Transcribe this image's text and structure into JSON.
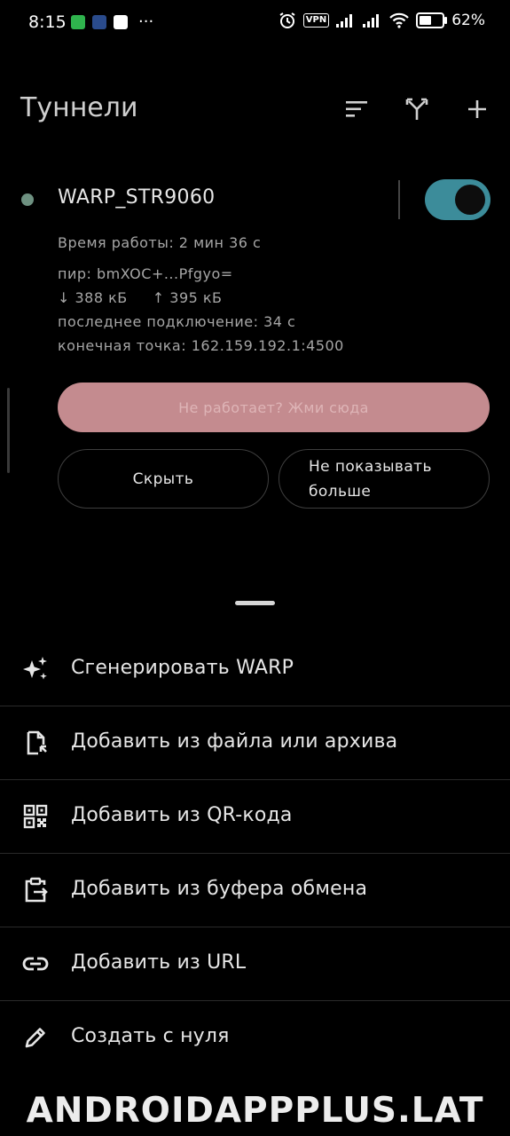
{
  "status_bar": {
    "time": "8:15",
    "left_icons": [
      "whatsapp-icon",
      "app-icon",
      "notes-icon"
    ],
    "more": "···",
    "vpn": "VPN",
    "battery_percent": 62,
    "battery_label": "62%"
  },
  "app_bar": {
    "title": "Туннели",
    "actions": [
      "sort-icon",
      "split-icon",
      "add-icon"
    ]
  },
  "tunnel": {
    "name": "WARP_STR9060",
    "active": true,
    "uptime": "Время работы: 2 мин 36 с",
    "peer": "пир: bmXOC+...Pfgyo=",
    "rx": "↓ 388 кБ",
    "tx": "↑ 395 кБ",
    "last_handshake": "последнее подключение: 34 с",
    "endpoint": "конечная точка: 162.159.192.1:4500",
    "help_button": "Не работает? Жми сюда",
    "hide_button": "Скрыть",
    "dont_show_line1": "Не показывать",
    "dont_show_line2": "больше"
  },
  "sheet": {
    "items": [
      {
        "icon": "sparkle-icon",
        "label": "Сгенерировать WARP"
      },
      {
        "icon": "file-icon",
        "label": "Добавить из файла или архива"
      },
      {
        "icon": "qr-code-icon",
        "label": "Добавить из QR-кода"
      },
      {
        "icon": "clipboard-icon",
        "label": "Добавить из буфера обмена"
      },
      {
        "icon": "link-icon",
        "label": "Добавить из URL"
      },
      {
        "icon": "pencil-icon",
        "label": "Создать с нуля"
      }
    ]
  },
  "watermark": "ANDROIDAPPPLUS.LAT",
  "colors": {
    "background": "#000000",
    "accent": "#3c8c9a",
    "status_dot": "#6e9181",
    "help_button": "#c48b8f"
  }
}
